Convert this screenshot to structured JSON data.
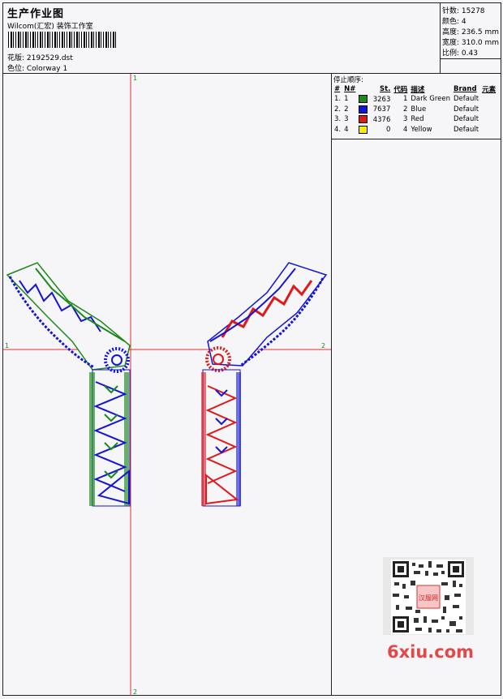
{
  "header": {
    "title": "生产作业图",
    "software": "Wilcom(汇宏) 装饰工作室",
    "design_label": "花版: 2192529.dst",
    "colorway_label": "色位:  Colorway 1"
  },
  "stats": {
    "stitches": "针数:  15278",
    "colors": "颜色:  4",
    "height": "高度:  236.5 mm",
    "width": "宽度:  310.0 mm",
    "scale": "比例:  0.43"
  },
  "canvas": {
    "axis_top": "1",
    "axis_left": "1",
    "axis_right": "2",
    "axis_bottom": "2"
  },
  "stop_sequence": {
    "title": "停止顺序:",
    "columns": [
      "#",
      "N#",
      "St.",
      "代码",
      "描述",
      "Brand",
      "元素"
    ],
    "rows": [
      {
        "idx": "1.",
        "n": "1",
        "color": "#1a8a1a",
        "st": "3263",
        "code": "1",
        "desc": "Dark Green",
        "brand": "Default"
      },
      {
        "idx": "2.",
        "n": "2",
        "color": "#1414d8",
        "st": "7637",
        "code": "2",
        "desc": "Blue",
        "brand": "Default"
      },
      {
        "idx": "3.",
        "n": "3",
        "color": "#e01818",
        "st": "4376",
        "code": "3",
        "desc": "Red",
        "brand": "Default"
      },
      {
        "idx": "4.",
        "n": "4",
        "color": "#f5ec00",
        "st": "0",
        "code": "4",
        "desc": "Yellow",
        "brand": "Default"
      }
    ]
  },
  "watermark": {
    "site": "6xiu.com",
    "seal": "汉服网"
  },
  "colors": {
    "axis": "#e03030",
    "green": "#1a8a1a",
    "blue": "#1414d8",
    "red": "#e01818"
  }
}
